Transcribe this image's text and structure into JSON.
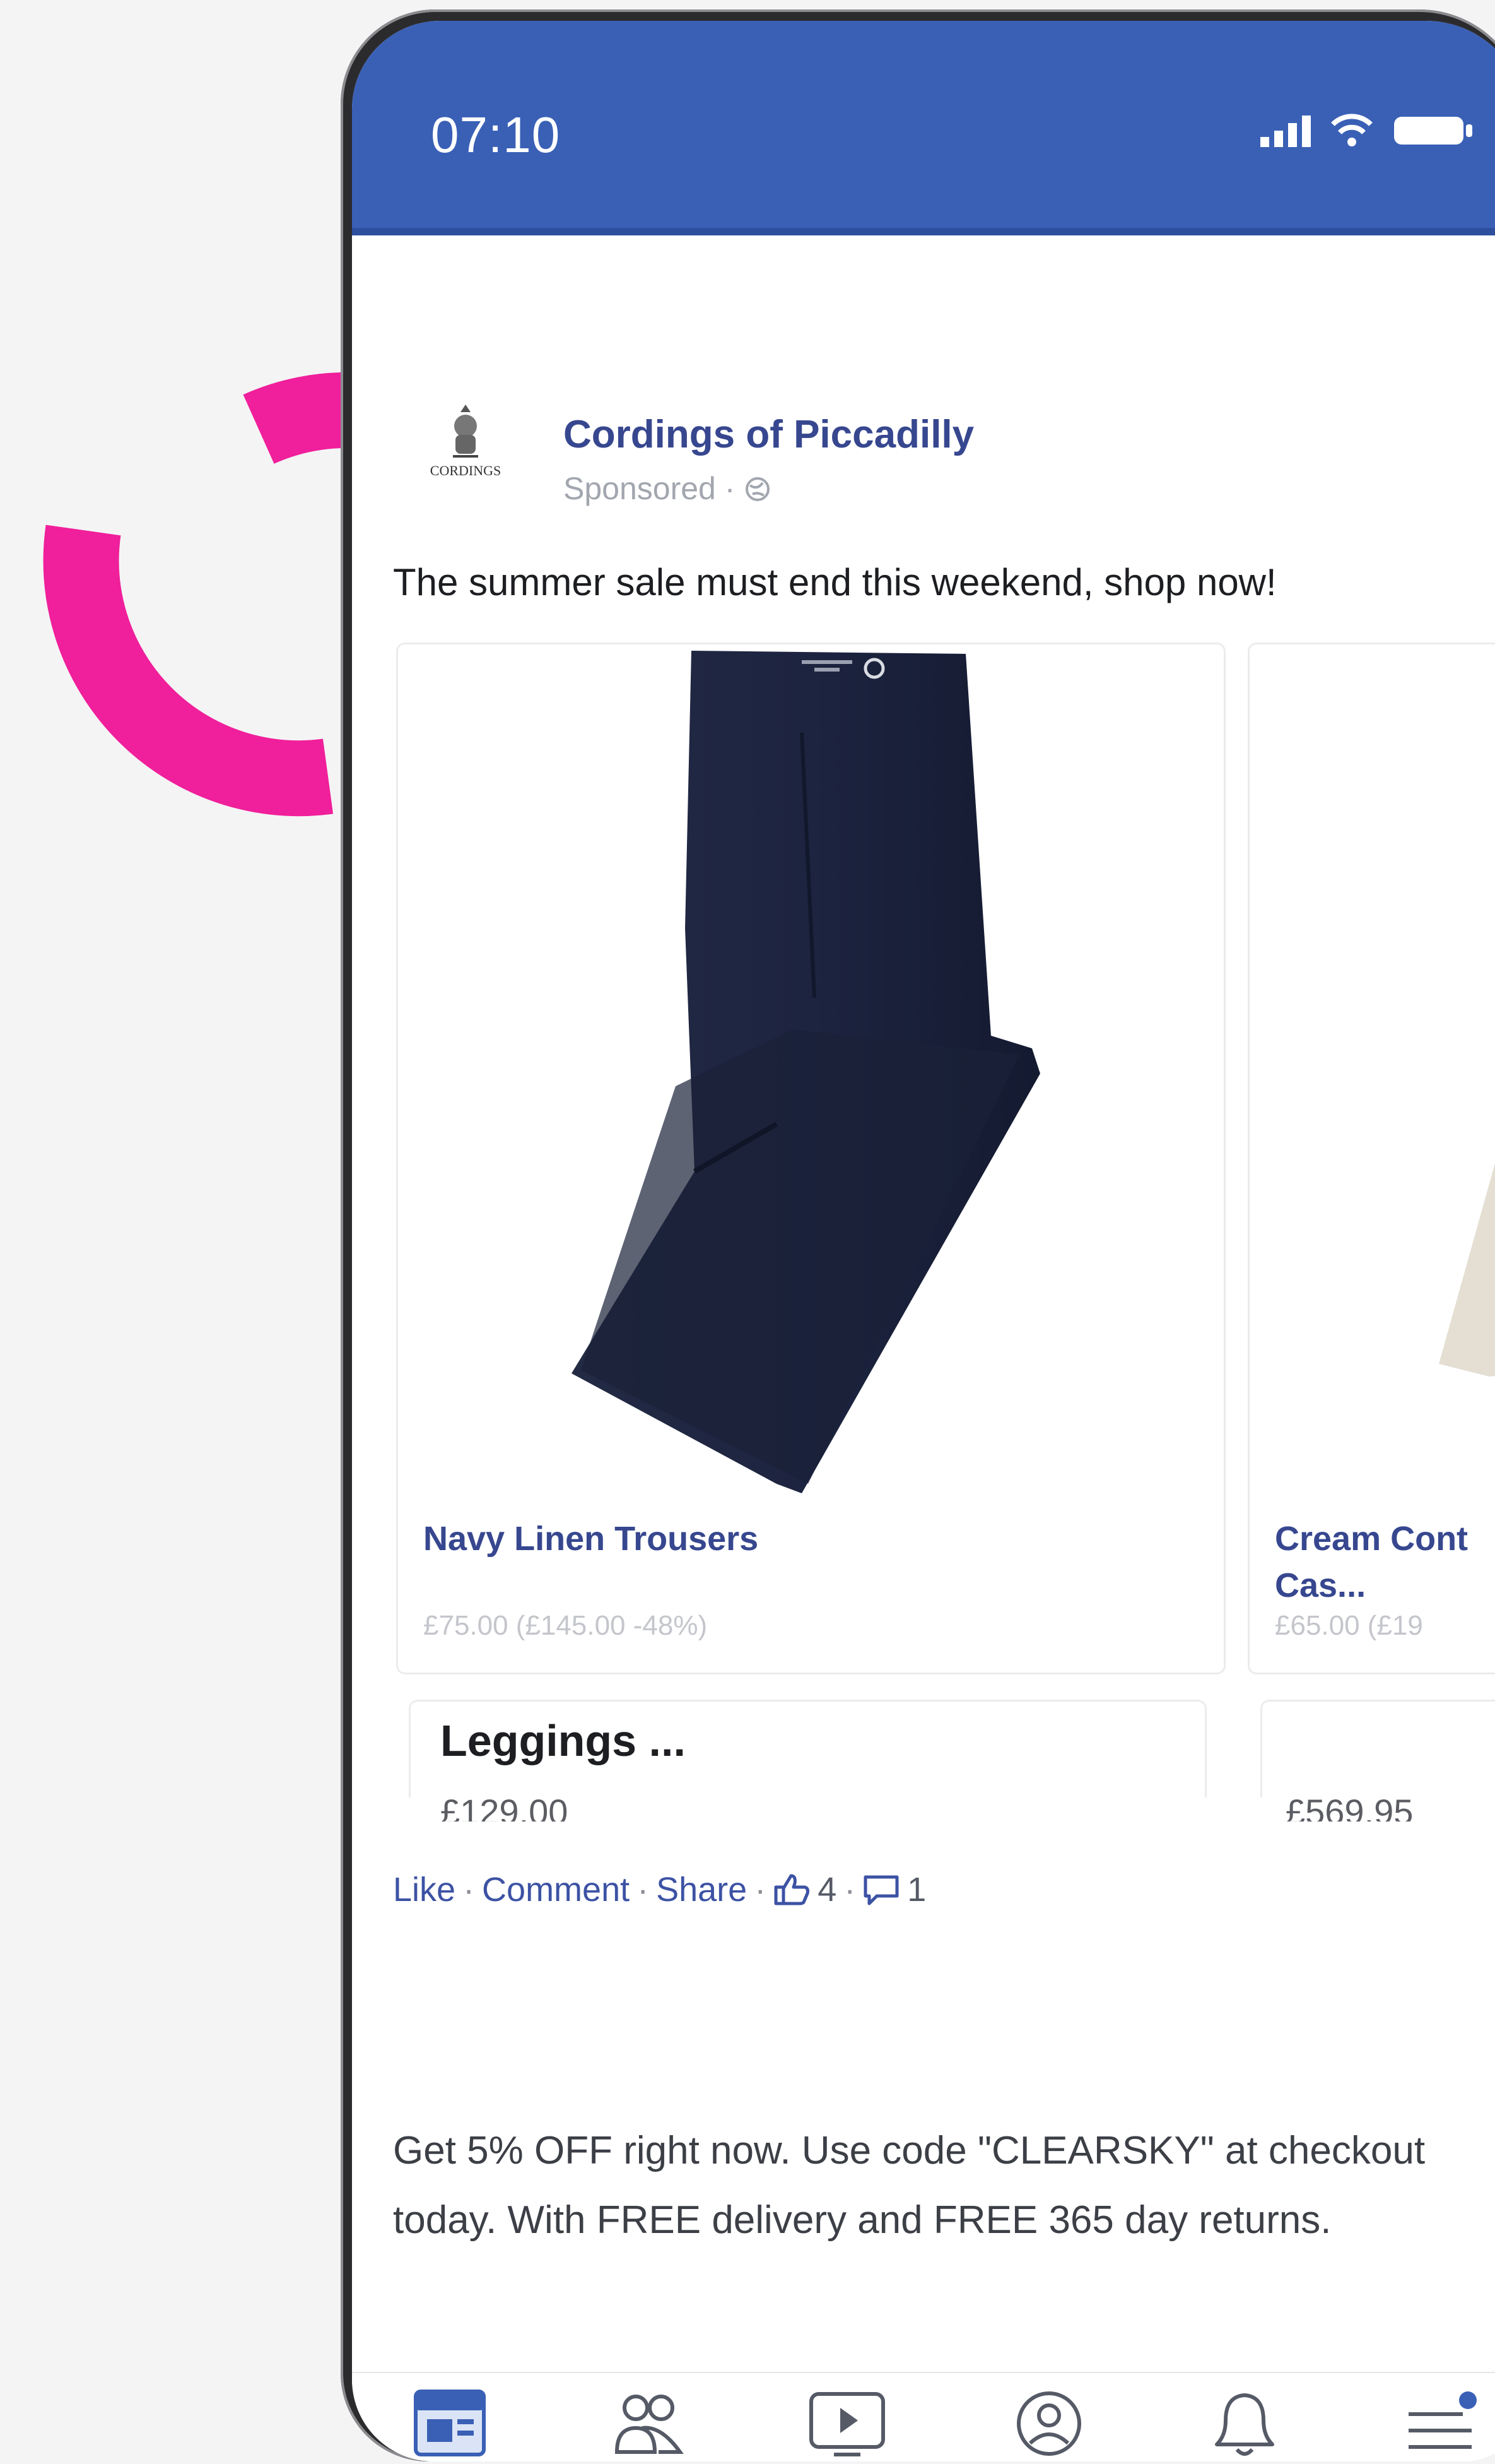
{
  "theme": {
    "accent": "#3a60b6",
    "decor": "#f01f9b",
    "link": "#37478f"
  },
  "status_bar": {
    "time": "07:10",
    "icons": [
      "signal-icon",
      "wifi-icon",
      "battery-icon"
    ]
  },
  "post": {
    "page_name": "Cordings of Piccadilly",
    "logo_text": "CORDINGS",
    "sponsored": "Sponsored · ",
    "globe_icon": "globe-icon",
    "caption": "The summer sale must end this weekend, shop now!",
    "products": [
      {
        "name": "Navy Linen Trousers",
        "price": "£75.00 (£145.00 -48%)"
      },
      {
        "name": "Cream Cont\nCas...",
        "price": "£65.00 (£19"
      }
    ],
    "next_row": [
      {
        "title": "Leggings ...",
        "price": "£129.00"
      },
      {
        "title": "",
        "price": "£569.95"
      }
    ],
    "actions": {
      "like": "Like",
      "comment": "Comment",
      "share": "Share",
      "likes_count": "4",
      "comments_count": "1",
      "separator": " · "
    },
    "promo": "Get 5% OFF right now. Use code \"CLEARSKY\" at checkout today. With FREE delivery and FREE 365 day returns."
  },
  "bottom_nav": {
    "items": [
      "news-feed-icon",
      "friends-icon",
      "watch-icon",
      "profile-icon",
      "notifications-icon",
      "menu-icon"
    ]
  }
}
